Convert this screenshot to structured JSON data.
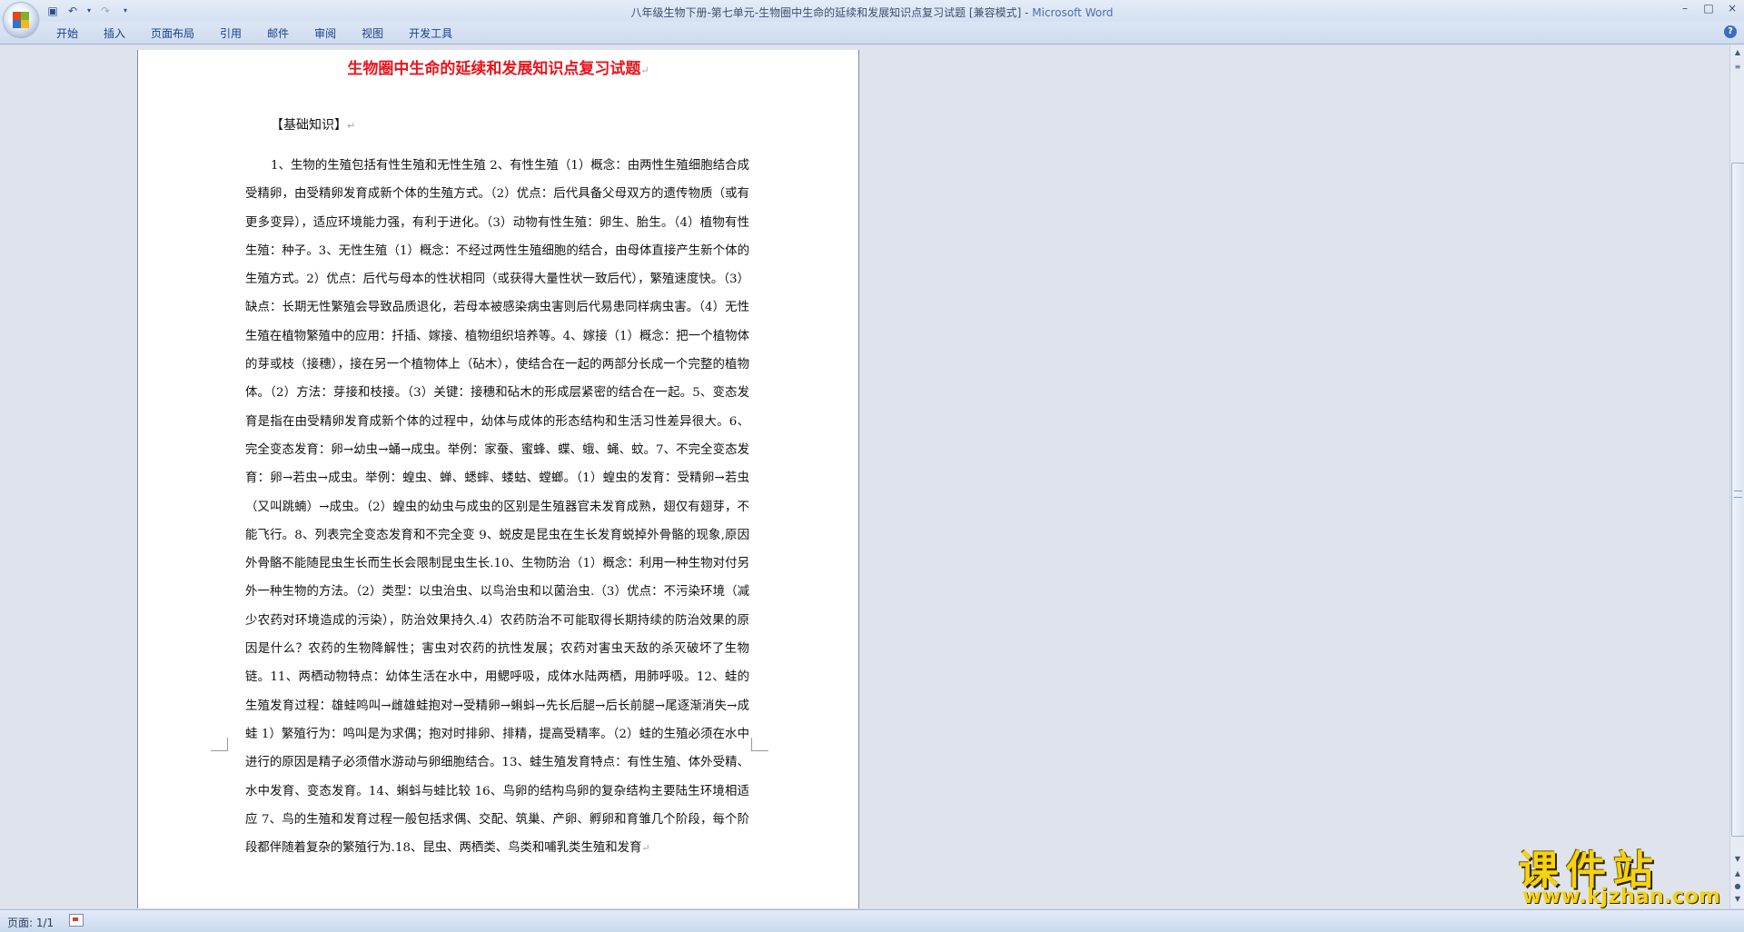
{
  "window": {
    "title": "八年级生物下册-第七单元-生物圈中生命的延续和发展知识点复习试题 [兼容模式] - ",
    "app_name": "Microsoft Word",
    "controls": [
      "–",
      "□",
      "×"
    ]
  },
  "quick_access": [
    "save-icon",
    "undo-icon",
    "redo-icon",
    "customize-icon"
  ],
  "ribbon": {
    "tabs": [
      "开始",
      "插入",
      "页面布局",
      "引用",
      "邮件",
      "审阅",
      "视图",
      "开发工具"
    ],
    "help_label": "?"
  },
  "document": {
    "title": "生物圈中生命的延续和发展知识点复习试题",
    "paragraph_mark": "↵",
    "section_heading": "【基础知识】",
    "body": "1、生物的生殖包括有性生殖和无性生殖 2、有性生殖（1）概念：由两性生殖细胞结合成受精卵，由受精卵发育成新个体的生殖方式。（2）优点：后代具备父母双方的遗传物质（或有更多变异），适应环境能力强，有利于进化。（3）动物有性生殖：卵生、胎生。（4）植物有性生殖：种子。3、无性生殖（1）概念：不经过两性生殖细胞的结合，由母体直接产生新个体的生殖方式。2）优点：后代与母本的性状相同（或获得大量性状一致后代），繁殖速度快。（3）缺点：长期无性繁殖会导致品质退化，若母本被感染病虫害则后代易患同样病虫害。（4）无性生殖在植物繁殖中的应用：扦插、嫁接、植物组织培养等。4、嫁接（1）概念：把一个植物体的芽或枝（接穗），接在另一个植物体上（砧木），使结合在一起的两部分长成一个完整的植物体。（2）方法：芽接和枝接。（3）关键：接穗和砧木的形成层紧密的结合在一起。5、变态发育是指在由受精卵发育成新个体的过程中，幼体与成体的形态结构和生活习性差异很大。6、完全变态发育：卵→幼虫→蛹→成虫。举例：家蚕、蜜蜂、蝶、蛾、蝇、蚊。7、不完全变态发育：卵→若虫→成虫。举例：蝗虫、蝉、蟋蟀、蝼蛄、螳螂。（1）蝗虫的发育：受精卵→若虫（又叫跳蝻）→成虫。（2）蝗虫的幼虫与成虫的区别是生殖器官未发育成熟，翅仅有翅芽，不能飞行。8、列表完全变态发育和不完全变 9、蜕皮是昆虫在生长发育蜕掉外骨骼的现象,原因外骨骼不能随昆虫生长而生长会限制昆虫生长.10、生物防治（1）概念：利用一种生物对付另外一种生物的方法。（2）类型：以虫治虫、以鸟治虫和以菌治虫.（3）优点：不污染环境（减少农药对环境造成的污染），防治效果持久.4）农药防治不可能取得长期持续的防治效果的原因是什么？农药的生物降解性；害虫对农药的抗性发展；农药对害虫天敌的杀灭破坏了生物链。11、两栖动物特点：幼体生活在水中，用鳃呼吸，成体水陆两栖，用肺呼吸。12、蛙的生殖发育过程：雄蛙鸣叫→雌雄蛙抱对→受精卵→蝌蚪→先长后腿→后长前腿→尾逐渐消失→成蛙 1）繁殖行为：鸣叫是为求偶；抱对时排卵、排精，提高受精率。（2）蛙的生殖必须在水中进行的原因是精子必须借水游动与卵细胞结合。13、蛙生殖发育特点：有性生殖、体外受精、水中发育、变态发育。14、蝌蚪与蛙比较 16、鸟卵的结构鸟卵的复杂结构主要陆生环境相适应 7、鸟的生殖和发育过程一般包括求偶、交配、筑巢、产卵、孵卵和育雏几个阶段，每个阶段都伴随着复杂的繁殖行为.18、昆虫、两栖类、鸟类和哺乳类生殖和发育"
  },
  "status_bar": {
    "page_count": "页面: 1/1"
  },
  "watermark": {
    "title": "课件站",
    "url": "www.kjzhan.com"
  },
  "colors": {
    "title_red": "#e8141b",
    "ribbon_text": "#15428b",
    "watermark_yellow": "#f6d210"
  }
}
